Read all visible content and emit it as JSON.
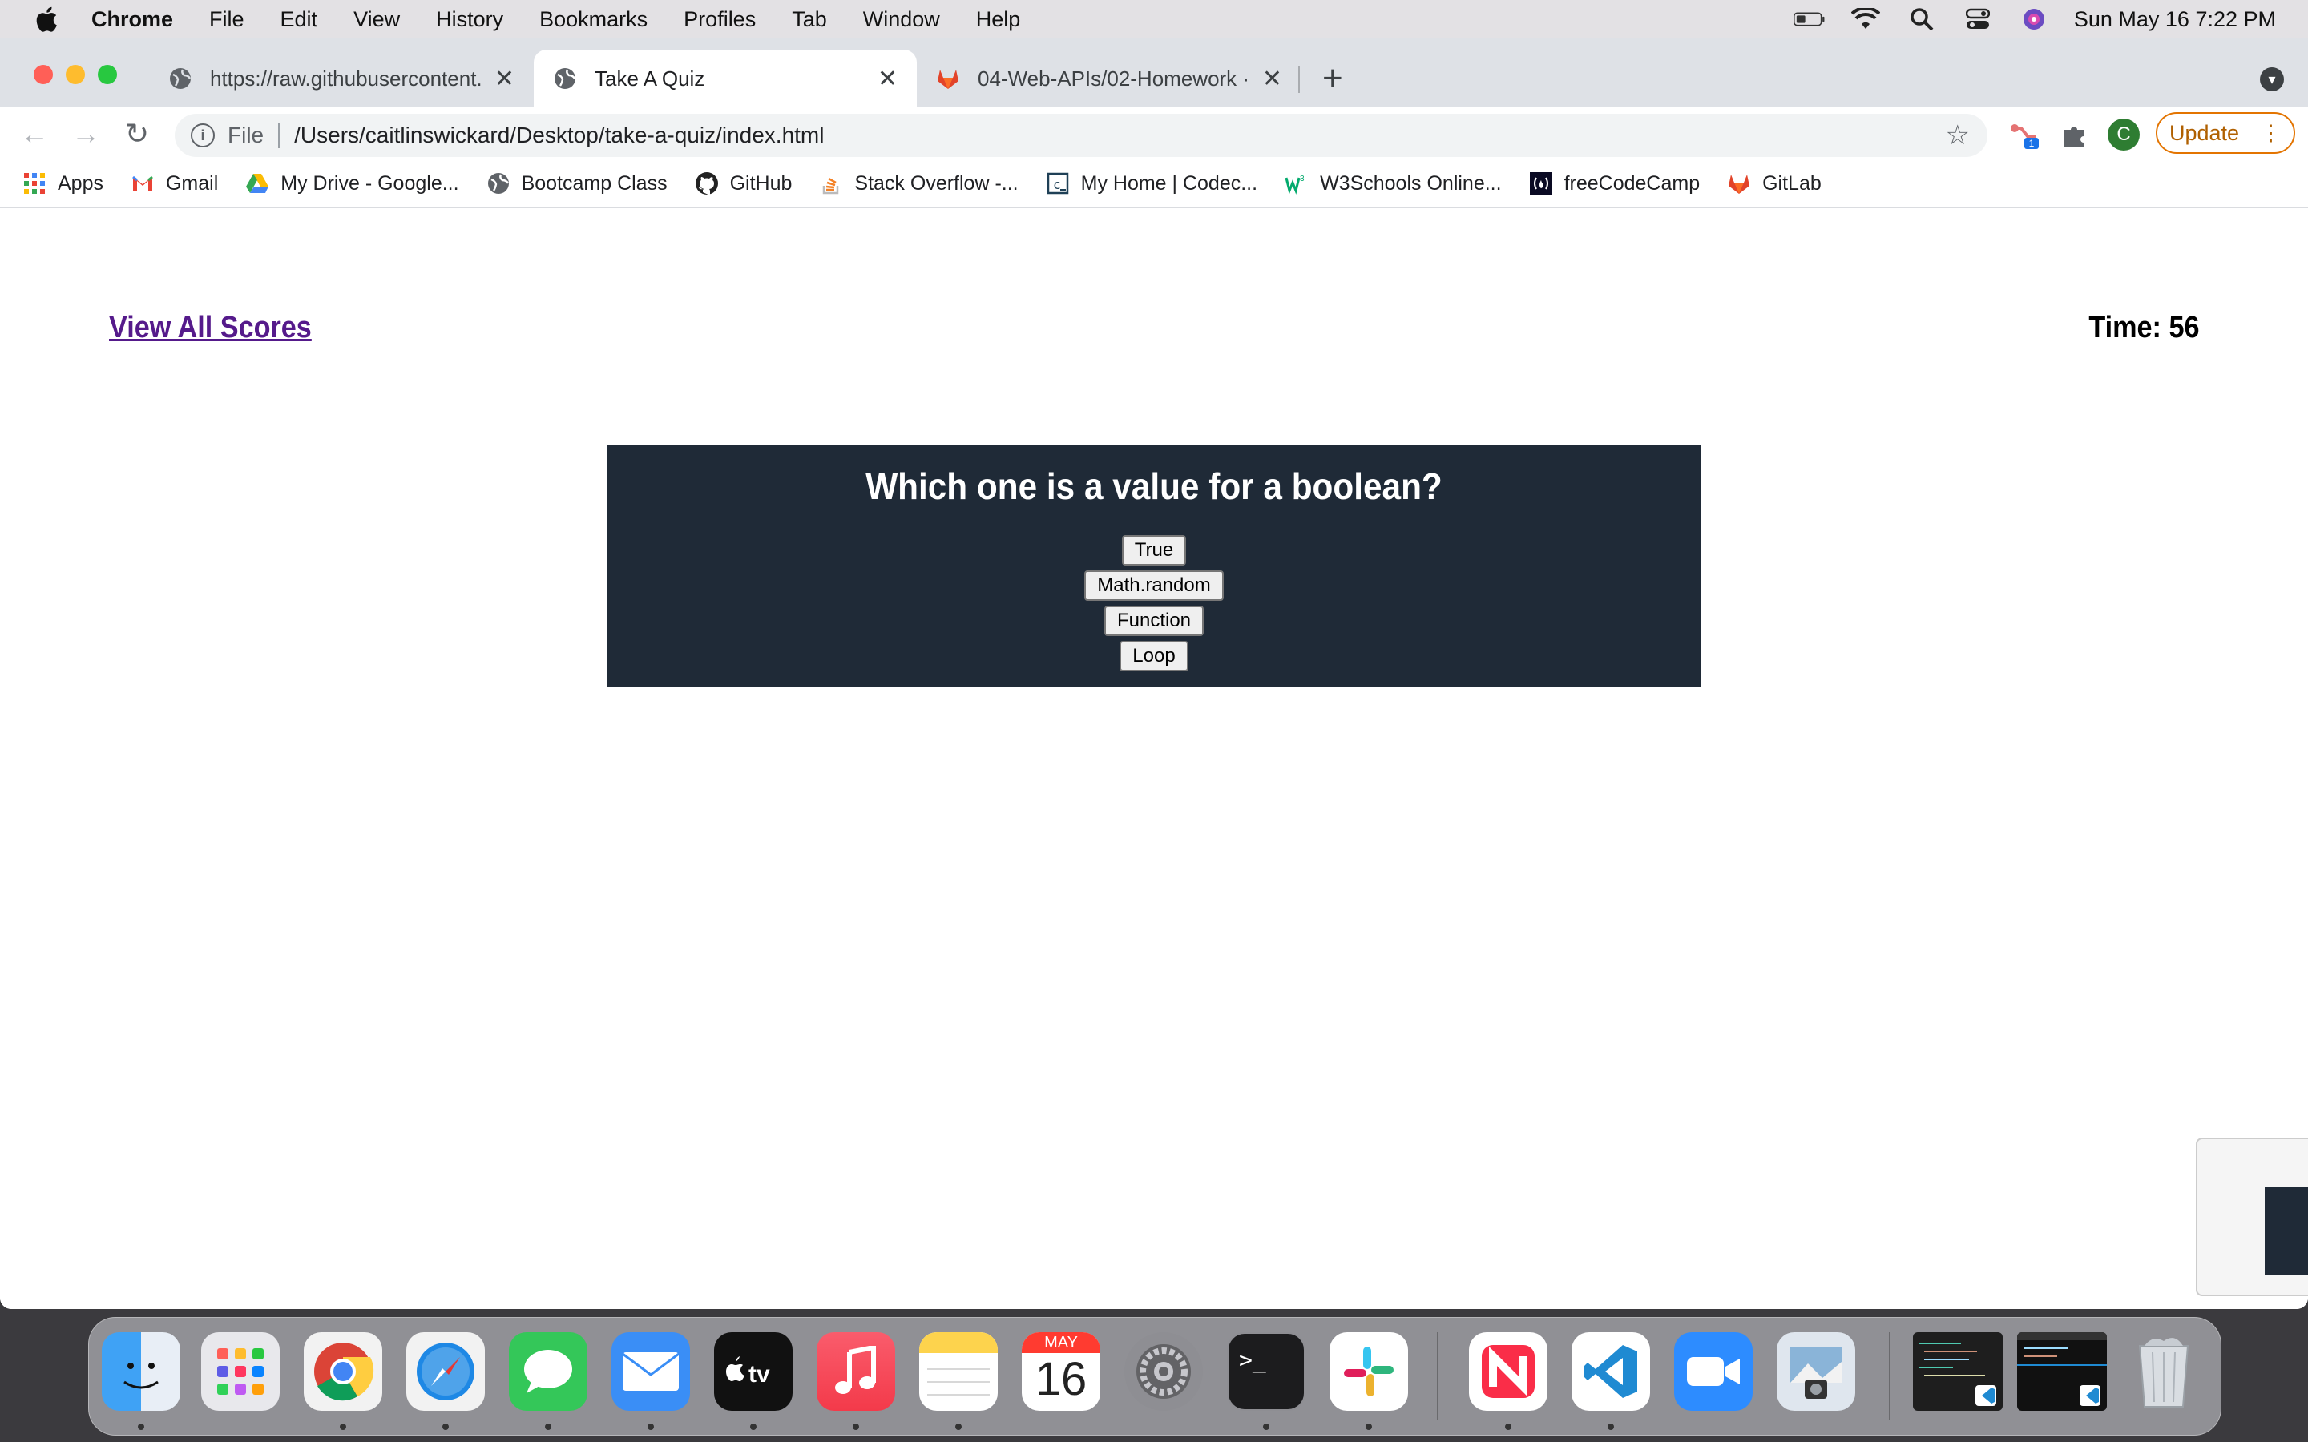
{
  "menubar": {
    "items": [
      "Chrome",
      "File",
      "Edit",
      "View",
      "History",
      "Bookmarks",
      "Profiles",
      "Tab",
      "Window",
      "Help"
    ],
    "clock": "Sun May 16  7:22 PM"
  },
  "tabs": [
    {
      "title": "https://raw.githubusercontent.c",
      "icon": "globe-icon"
    },
    {
      "title": "Take A Quiz",
      "icon": "globe-icon"
    },
    {
      "title": "04-Web-APIs/02-Homework · ",
      "icon": "gitlab-icon"
    }
  ],
  "address_bar": {
    "scheme": "File",
    "url": "/Users/caitlinswickard/Desktop/take-a-quiz/index.html"
  },
  "toolbar": {
    "profile_initial": "C",
    "update_label": "Update",
    "extension_badge": "1"
  },
  "bookmarks": [
    {
      "label": "Apps",
      "icon": "apps-grid-icon"
    },
    {
      "label": "Gmail",
      "icon": "gmail-icon"
    },
    {
      "label": "My Drive - Google...",
      "icon": "google-drive-icon"
    },
    {
      "label": "Bootcamp Class",
      "icon": "globe-icon"
    },
    {
      "label": "GitHub",
      "icon": "github-icon"
    },
    {
      "label": "Stack Overflow -...",
      "icon": "stackoverflow-icon"
    },
    {
      "label": "My Home | Codec...",
      "icon": "codecademy-icon"
    },
    {
      "label": "W3Schools Online...",
      "icon": "w3schools-icon"
    },
    {
      "label": "freeCodeCamp",
      "icon": "freecodecamp-icon"
    },
    {
      "label": "GitLab",
      "icon": "gitlab-icon"
    }
  ],
  "quiz": {
    "view_scores_label": "View All Scores",
    "timer_label": "Time: 56",
    "question": "Which one is a value for a boolean?",
    "answers": [
      "True",
      "Math.random",
      "Function",
      "Loop"
    ]
  },
  "dock": {
    "apps": [
      "Finder",
      "Launchpad",
      "Chrome",
      "Safari",
      "Messages",
      "Mail",
      "Apple TV",
      "Music",
      "Notes",
      "Calendar",
      "System Preferences",
      "Terminal",
      "Slack",
      "News",
      "Visual Studio Code",
      "Zoom",
      "Preview",
      "Trash"
    ],
    "calendar_month": "MAY",
    "calendar_day": "16"
  },
  "colors": {
    "quiz_background": "#1f2a37",
    "link_visited": "#551a8b",
    "update_accent": "#e37400"
  }
}
